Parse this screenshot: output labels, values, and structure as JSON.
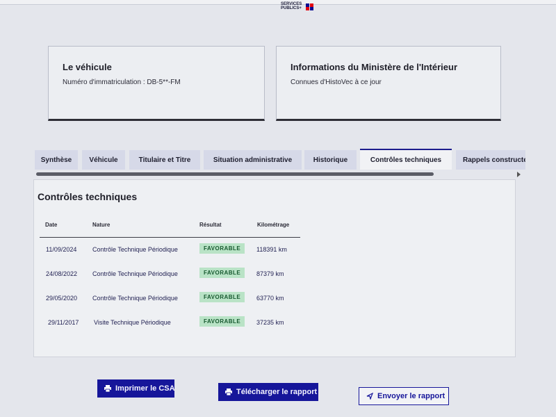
{
  "header": {
    "logo_line1": "SERVICES",
    "logo_line2": "PUBLICS+",
    "logo_colors": [
      "#0a0a91",
      "#e1000f",
      "#0a0a91",
      "#e1000f"
    ]
  },
  "vehicle_card": {
    "title": "Le véhicule",
    "plate_label": "Numéro d'immatriculation : DB-5**-FM"
  },
  "ministry_card": {
    "title": "Informations du Ministère de l'Intérieur",
    "subtitle": "Connues d'HistoVec à ce jour"
  },
  "tabs": [
    {
      "label": "Synthèse",
      "active": false
    },
    {
      "label": "Véhicule",
      "active": false
    },
    {
      "label": "Titulaire et Titre",
      "active": false
    },
    {
      "label": "Situation administrative",
      "active": false
    },
    {
      "label": "Historique",
      "active": false
    },
    {
      "label": "Contrôles techniques",
      "active": true
    },
    {
      "label": "Rappels constructeur",
      "active": false
    }
  ],
  "section": {
    "title": "Contrôles techniques",
    "columns": {
      "date": "Date",
      "nature": "Nature",
      "result": "Résultat",
      "mileage": "Kilométrage"
    },
    "rows": [
      {
        "date": "11/09/2024",
        "nature": "Contrôle Technique Périodique",
        "result": "FAVORABLE",
        "mileage": "118391 km"
      },
      {
        "date": "24/08/2022",
        "nature": "Contrôle Technique Périodique",
        "result": "FAVORABLE",
        "mileage": "87379 km"
      },
      {
        "date": "29/05/2020",
        "nature": "Contrôle Technique Périodique",
        "result": "FAVORABLE",
        "mileage": "63770 km"
      },
      {
        "date": "29/11/2017",
        "nature": "Visite Technique Périodique",
        "result": "FAVORABLE",
        "mileage": "37235 km"
      }
    ]
  },
  "actions": {
    "print_csa": "Imprimer le CSA",
    "download_report": "Télécharger le rapport",
    "send_report": "Envoyer le rapport"
  },
  "icons": {
    "print_csa": "printer-icon",
    "download_report": "printer-icon",
    "send_report": "send-arrow-icon"
  },
  "colors": {
    "primary": "#16169a",
    "badge_bg": "#b9e3c6",
    "badge_text": "#17592f",
    "active_tab_border": "#1c1c8c"
  }
}
